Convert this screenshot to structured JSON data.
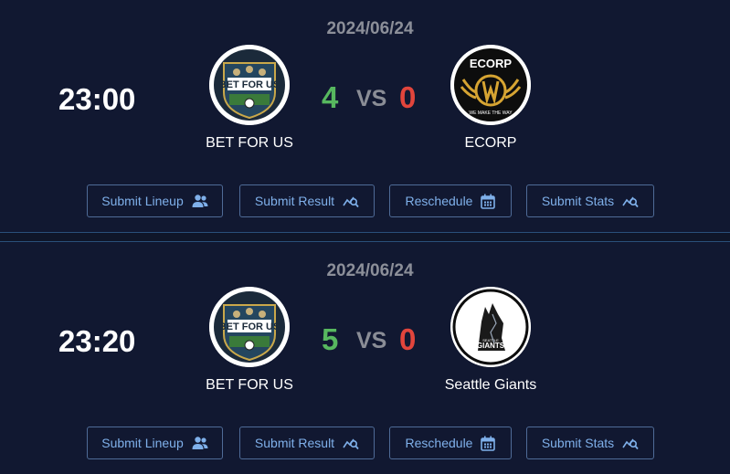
{
  "matches": [
    {
      "date": "2024/06/24",
      "time": "23:00",
      "home": {
        "name": "BET FOR US",
        "score": "4",
        "logo_text": "BET FOR US"
      },
      "vs": "VS",
      "away": {
        "name": "ECORP",
        "score": "0",
        "logo_text": "ECORP",
        "logo_tagline": "WE MAKE THE WAY"
      }
    },
    {
      "date": "2024/06/24",
      "time": "23:20",
      "home": {
        "name": "BET FOR US",
        "score": "5",
        "logo_text": "BET FOR US"
      },
      "vs": "VS",
      "away": {
        "name": "Seattle Giants",
        "score": "0",
        "logo_text": "GIANTS",
        "logo_tagline": "SEATTLE"
      }
    }
  ],
  "actions": {
    "lineup": {
      "label": "Submit Lineup",
      "icon": "users-icon"
    },
    "result": {
      "label": "Submit Result",
      "icon": "chart-search-icon"
    },
    "reschedule": {
      "label": "Reschedule",
      "icon": "calendar-icon"
    },
    "stats": {
      "label": "Submit Stats",
      "icon": "chart-search-icon"
    }
  },
  "colors": {
    "win_score": "#57b85f",
    "lose_score": "#e2453c",
    "button_text": "#7fb0ea",
    "card_background": "#111831"
  }
}
